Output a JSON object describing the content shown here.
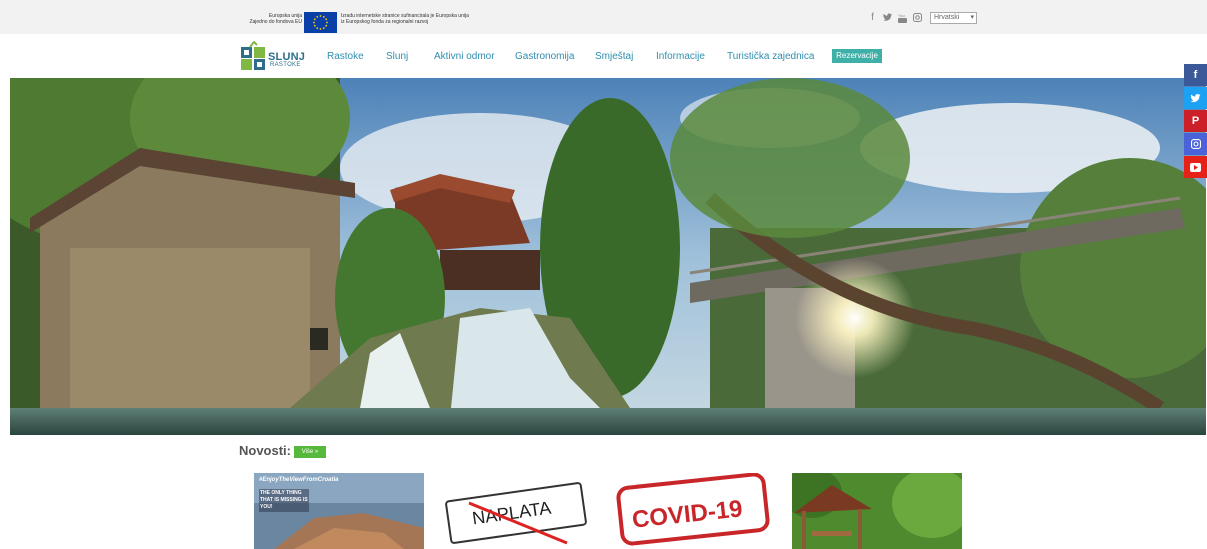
{
  "eu_bar": {
    "left_text_1": "Europska unija",
    "left_text_2": "Zajedno do fondova EU",
    "right_text_1": "Izradu internetske stranice sufinancirala je Europska unija",
    "right_text_2": "iz Europskog fonda za regionalni razvoj",
    "language": "Hrvatski"
  },
  "logo": {
    "name": "SLUNJ",
    "sub": "RASTOKE"
  },
  "nav": {
    "items": [
      "Rastoke",
      "Slunj",
      "Aktivni odmor",
      "Gastronomija",
      "Smještaj",
      "Informacije",
      "Turistička zajednica"
    ],
    "button": "Rezervacije"
  },
  "news": {
    "title": "Novosti:",
    "more": "Više »",
    "card1_tag": "#EnjoyTheViewFromCroatia",
    "card1_line1": "THE ONLY THING",
    "card1_line2": "THAT IS MISSING IS",
    "card1_line3": "YOU!",
    "card2_text": "NAPLATA",
    "card3_text": "COVID-19"
  },
  "colors": {
    "accent": "#3fb0a8",
    "nav_text": "#2f8fb0",
    "more_button": "#56b93c"
  }
}
